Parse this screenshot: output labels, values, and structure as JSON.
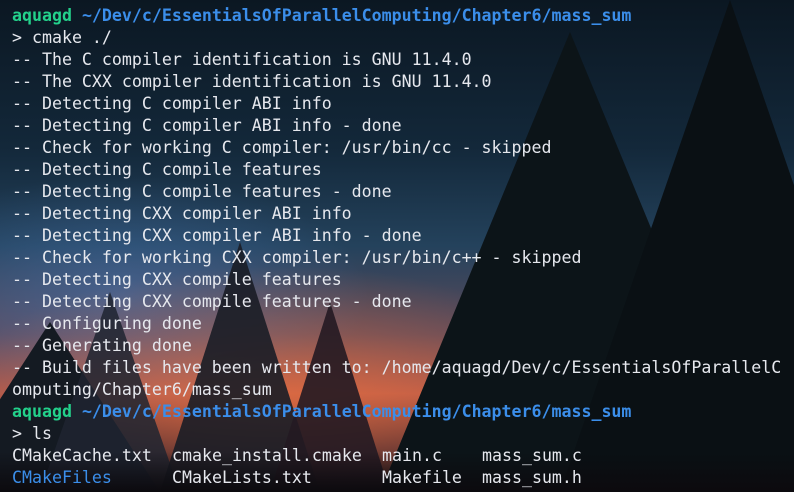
{
  "prompt1": {
    "user": "aquagd",
    "path": " ~/Dev/c/EssentialsOfParallelComputing/Chapter6/mass_sum"
  },
  "command1": "> cmake ./",
  "output": [
    "-- The C compiler identification is GNU 11.4.0",
    "-- The CXX compiler identification is GNU 11.4.0",
    "-- Detecting C compiler ABI info",
    "-- Detecting C compiler ABI info - done",
    "-- Check for working C compiler: /usr/bin/cc - skipped",
    "-- Detecting C compile features",
    "-- Detecting C compile features - done",
    "-- Detecting CXX compiler ABI info",
    "-- Detecting CXX compiler ABI info - done",
    "-- Check for working CXX compiler: /usr/bin/c++ - skipped",
    "-- Detecting CXX compile features",
    "-- Detecting CXX compile features - done",
    "-- Configuring done",
    "-- Generating done",
    "-- Build files have been written to: /home/aquagd/Dev/c/EssentialsOfParallelC",
    "omputing/Chapter6/mass_sum"
  ],
  "prompt2": {
    "user": "aquagd",
    "path": " ~/Dev/c/EssentialsOfParallelComputing/Chapter6/mass_sum"
  },
  "command2": "> ls",
  "ls_rows": [
    [
      "CMakeCache.txt",
      "cmake_install.cmake",
      "main.c",
      "mass_sum.c"
    ],
    [
      "CMakeFiles",
      "CMakeLists.txt",
      "Makefile",
      "mass_sum.h"
    ]
  ],
  "colors": {
    "user": "#23d18b",
    "path": "#3b8eea",
    "text": "#e6e8ee",
    "directory": "#3b8eea"
  }
}
